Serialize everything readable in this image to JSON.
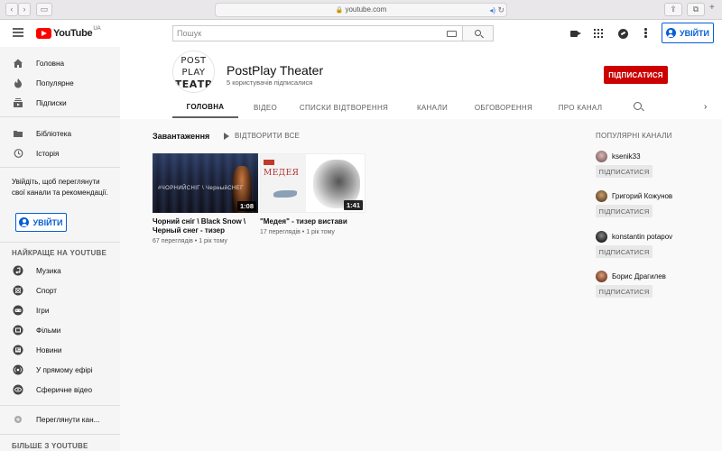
{
  "browser": {
    "url": "youtube.com"
  },
  "masthead": {
    "logo_text": "YouTube",
    "region": "UA",
    "search_placeholder": "Пошук",
    "signin_label": "УВІЙТИ"
  },
  "sidebar": {
    "main_items": [
      {
        "label": "Головна",
        "icon": "home-icon"
      },
      {
        "label": "Популярне",
        "icon": "trending-icon"
      },
      {
        "label": "Підписки",
        "icon": "subscriptions-icon"
      }
    ],
    "library_items": [
      {
        "label": "Бібліотека",
        "icon": "library-icon"
      },
      {
        "label": "Історія",
        "icon": "history-icon"
      }
    ],
    "signin_note": "Увійдіть, щоб переглянути свої канали та рекомендації.",
    "signin_label": "УВІЙТИ",
    "best_heading": "НАЙКРАЩЕ НА YOUTUBE",
    "best_items": [
      {
        "label": "Музика",
        "icon": "music-icon"
      },
      {
        "label": "Спорт",
        "icon": "sports-icon"
      },
      {
        "label": "Ігри",
        "icon": "gaming-icon"
      },
      {
        "label": "Фільми",
        "icon": "movies-icon"
      },
      {
        "label": "Новини",
        "icon": "news-icon"
      },
      {
        "label": "У прямому ефірі",
        "icon": "live-icon"
      },
      {
        "label": "Сферичне відео",
        "icon": "360-video-icon"
      }
    ],
    "browse_channels": "Переглянути кан...",
    "more_heading": "БІЛЬШЕ З YOUTUBE"
  },
  "channel": {
    "avatar_lines": [
      "POST",
      "PLAY",
      "ТЕАТР"
    ],
    "name": "PostPlay Theater",
    "subscribers": "5 користувачів підписалися",
    "subscribe_label": "ПІДПИСАТИСЯ",
    "tabs": [
      "ГОЛОВНА",
      "ВІДЕО",
      "СПИСКИ ВІДТВОРЕННЯ",
      "КАНАЛИ",
      "ОБГОВОРЕННЯ",
      "ПРО КАНАЛ"
    ]
  },
  "uploads": {
    "title": "Завантаження",
    "play_all": "ВІДТВОРИТИ ВСЕ",
    "videos": [
      {
        "title": "Чорний сніг \\ Black Snow \\ Черный снег - тизер",
        "duration": "1:08",
        "thumb_text": "#ЧОРНИЙСНІГ \\ ЧерныйСНЕГ",
        "views": "67 переглядів",
        "age": "1 рік тому"
      },
      {
        "title": "\"Медея\" - тизер вистави",
        "duration": "1:41",
        "thumb_text": "МЕДЕЯ",
        "views": "17 переглядів",
        "age": "1 рік тому"
      }
    ]
  },
  "popular_channels": {
    "heading": "ПОПУЛЯРНІ КАНАЛИ",
    "subscribe_label": "ПІДПИСАТИСЯ",
    "channels": [
      {
        "name": "ksenik33"
      },
      {
        "name": "Григорий Кожунов"
      },
      {
        "name": "konstantin potapov"
      },
      {
        "name": "Борис Драгилев"
      }
    ]
  },
  "colors": {
    "accent_blue": "#065fd4",
    "subscribe_red": "#cc0000",
    "youtube_red": "#ff0000"
  }
}
